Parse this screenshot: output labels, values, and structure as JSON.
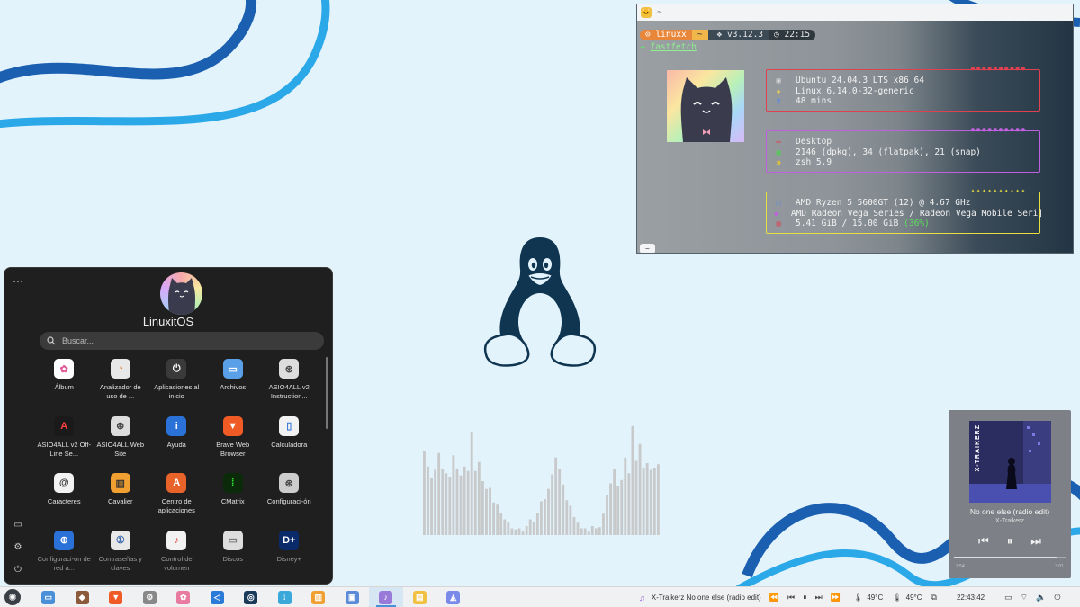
{
  "terminal": {
    "title": "~",
    "prompt": {
      "user": "linuxx",
      "dir": "~",
      "version": "v3.12.3",
      "time": "22:15"
    },
    "command": "fastfetch",
    "box1": [
      {
        "icon": "monitor-icon",
        "text": "Ubuntu 24.04.3 LTS x86_64"
      },
      {
        "icon": "kernel-icon",
        "text": "Linux 6.14.0-32-generic"
      },
      {
        "icon": "hourglass-icon",
        "text": "48 mins"
      }
    ],
    "box2": [
      {
        "icon": "desktop-icon",
        "text": "Desktop"
      },
      {
        "icon": "package-icon",
        "text": "2146 (dpkg), 34 (flatpak), 21 (snap)"
      },
      {
        "icon": "shell-icon",
        "text": "zsh 5.9"
      }
    ],
    "box3": [
      {
        "icon": "cpu-icon",
        "text": "AMD Ryzen 5 5600GT (12) @ 4.67 GHz"
      },
      {
        "icon": "gpu-icon",
        "text": "AMD Radeon Vega Series / Radeon Vega Mobile Seri]"
      },
      {
        "icon": "memory-icon",
        "text": "5.41 GiB / 15.00 GiB",
        "pct": "(36%)"
      }
    ],
    "bottom_prompt": "~"
  },
  "startmenu": {
    "user": "LinuxitOS",
    "search_placeholder": "Buscar...",
    "apps": [
      {
        "label": "Álbum",
        "color": "#ffffff",
        "glyph": "✿",
        "fg": "#e05a9a"
      },
      {
        "label": "Analizador de uso de ...",
        "color": "#e8e8e8",
        "glyph": "◔",
        "fg": "#e07a2a"
      },
      {
        "label": "Aplicaciones al inicio",
        "color": "#3a3a3a",
        "glyph": "⏻",
        "fg": "#ffffff"
      },
      {
        "label": "Archivos",
        "color": "#5aa0e8",
        "glyph": "▭",
        "fg": "#ffffff"
      },
      {
        "label": "ASIO4ALL v2 Instruction...",
        "color": "#dddddd",
        "glyph": "⊛",
        "fg": "#444444"
      },
      {
        "label": "ASIO4ALL v2 Off-Line Se...",
        "color": "#1a1a1a",
        "glyph": "A",
        "fg": "#ff4040"
      },
      {
        "label": "ASIO4ALL Web Site",
        "color": "#dddddd",
        "glyph": "⊛",
        "fg": "#444444"
      },
      {
        "label": "Ayuda",
        "color": "#2a72d8",
        "glyph": "i",
        "fg": "#ffffff"
      },
      {
        "label": "Brave Web Browser",
        "color": "#f05a24",
        "glyph": "▼",
        "fg": "#ffffff"
      },
      {
        "label": "Calculadora",
        "color": "#f2f2f2",
        "glyph": "▯",
        "fg": "#3a7ad8"
      },
      {
        "label": "Caracteres",
        "color": "#f2f2f2",
        "glyph": "@",
        "fg": "#333333"
      },
      {
        "label": "Cavalier",
        "color": "#f0a030",
        "glyph": "▥",
        "fg": "#333333"
      },
      {
        "label": "Centro de aplicaciones",
        "color": "#e8632a",
        "glyph": "A",
        "fg": "#ffffff"
      },
      {
        "label": "CMatrix",
        "color": "#0a2a0a",
        "glyph": "⁞",
        "fg": "#30e030"
      },
      {
        "label": "Configuraci-ón",
        "color": "#cccccc",
        "glyph": "⊛",
        "fg": "#444444"
      },
      {
        "label": "Configuraci-ón de red a...",
        "color": "#2a72d8",
        "glyph": "⊕",
        "fg": "#ffffff"
      },
      {
        "label": "Contraseñas y claves",
        "color": "#e8e8e8",
        "glyph": "①",
        "fg": "#2a5aa8"
      },
      {
        "label": "Control de volumen",
        "color": "#f2f2f2",
        "glyph": "♪",
        "fg": "#e04040"
      },
      {
        "label": "Discos",
        "color": "#dddddd",
        "glyph": "▭",
        "fg": "#777777"
      },
      {
        "label": "Disney+",
        "color": "#0a2a6a",
        "glyph": "D+",
        "fg": "#ffffff"
      }
    ]
  },
  "visualizer": {
    "bar_levels": [
      0.75,
      0.61,
      0.51,
      0.58,
      0.73,
      0.59,
      0.55,
      0.52,
      0.71,
      0.59,
      0.53,
      0.61,
      0.57,
      0.92,
      0.57,
      0.65,
      0.48,
      0.41,
      0.42,
      0.29,
      0.27,
      0.2,
      0.14,
      0.11,
      0.06,
      0.05,
      0.06,
      0.03,
      0.08,
      0.14,
      0.12,
      0.2,
      0.3,
      0.32,
      0.41,
      0.54,
      0.69,
      0.59,
      0.45,
      0.31,
      0.26,
      0.16,
      0.11,
      0.06,
      0.06,
      0.03,
      0.08,
      0.06,
      0.07,
      0.19,
      0.36,
      0.46,
      0.59,
      0.44,
      0.49,
      0.69,
      0.55,
      0.97,
      0.66,
      0.81,
      0.6,
      0.64,
      0.58,
      0.6,
      0.63
    ]
  },
  "player": {
    "cover_text": "X-TRAIKERZ",
    "song": "No one else (radio edit)",
    "artist": "X-Traikerz",
    "progress": 0.93,
    "time_elapsed": "2:54",
    "time_total": "3:01"
  },
  "taskbar": {
    "apps": [
      {
        "name": "files",
        "color": "#4a90d9",
        "glyph": "▭",
        "active": false
      },
      {
        "name": "game",
        "color": "#8a5a3a",
        "glyph": "◆",
        "active": false
      },
      {
        "name": "brave",
        "color": "#f05a24",
        "glyph": "▼",
        "active": false
      },
      {
        "name": "settings",
        "color": "#888888",
        "glyph": "⚙",
        "active": false
      },
      {
        "name": "photos",
        "color": "#e87aa0",
        "glyph": "✿",
        "active": false
      },
      {
        "name": "vscode",
        "color": "#2a7ad8",
        "glyph": "◁",
        "active": false
      },
      {
        "name": "steam",
        "color": "#1a3a5a",
        "glyph": "◎",
        "active": false
      },
      {
        "name": "equalizer",
        "color": "#3aa8d8",
        "glyph": "⦙",
        "active": false
      },
      {
        "name": "cavalier",
        "color": "#f0a030",
        "glyph": "▥",
        "active": false
      },
      {
        "name": "software",
        "color": "#5a8ad8",
        "glyph": "▣",
        "active": false
      },
      {
        "name": "music",
        "color": "#9a7ad8",
        "glyph": "♪",
        "active": true
      },
      {
        "name": "notes",
        "color": "#f0c040",
        "glyph": "▤",
        "active": false
      },
      {
        "name": "gallery",
        "color": "#7a8ae8",
        "glyph": "◭",
        "active": false
      }
    ],
    "now_playing": "X-Traikerz No one else (radio edit)",
    "cpu_temp": "49°C",
    "gpu_temp": "49°C",
    "clock": "22:43:42"
  }
}
